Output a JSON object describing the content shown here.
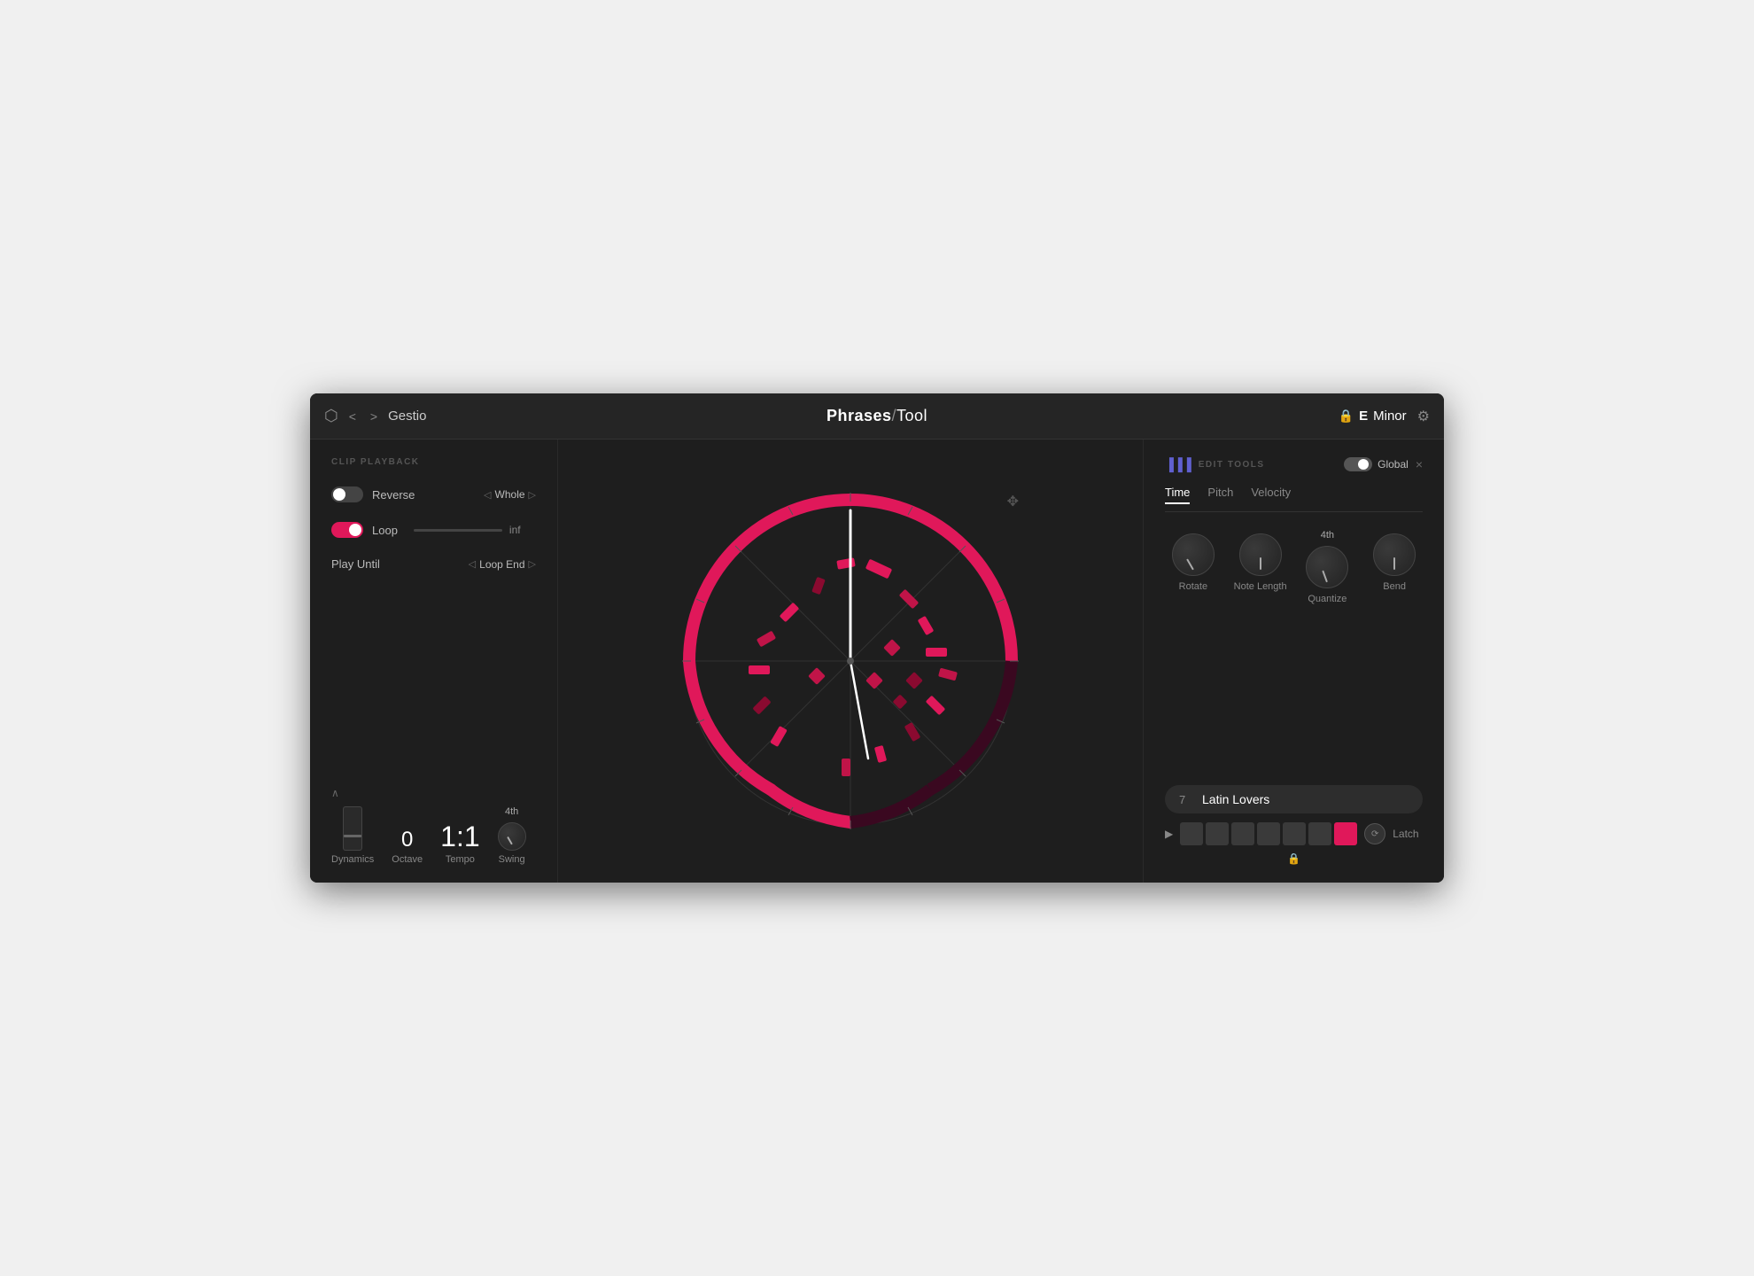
{
  "header": {
    "app_title": "Gestio",
    "logo_phrases": "Phrases",
    "logo_slash": "/",
    "logo_tool": "Tool",
    "key_note": "E",
    "key_scale": "Minor",
    "nav_back": "<",
    "nav_forward": ">"
  },
  "clip_playback": {
    "section_label": "CLIP PLAYBACK",
    "reverse_label": "Reverse",
    "reverse_active": false,
    "whole_label": "Whole",
    "loop_label": "Loop",
    "loop_active": true,
    "loop_end_label": "Loop End",
    "play_until_label": "Play Until",
    "inf_label": "inf"
  },
  "bottom_controls": {
    "dynamics_label": "Dynamics",
    "octave_label": "Octave",
    "octave_value": "0",
    "tempo_label": "Tempo",
    "tempo_value": "1:1",
    "swing_label": "Swing",
    "swing_4th": "4th"
  },
  "edit_tools": {
    "section_label": "EDIT TOOLS",
    "global_label": "Global",
    "tabs": [
      "Time",
      "Pitch",
      "Velocity"
    ],
    "active_tab": "Time",
    "knobs": [
      {
        "label": "Rotate",
        "sublabel": ""
      },
      {
        "label": "Note Length",
        "sublabel": ""
      },
      {
        "label": "Quantize",
        "sublabel": "4th"
      },
      {
        "label": "Bend",
        "sublabel": ""
      }
    ]
  },
  "phrase": {
    "number": "7",
    "name": "Latin Lovers",
    "latch_label": "Latch",
    "pads": [
      false,
      false,
      false,
      false,
      false,
      false,
      true
    ]
  },
  "icons": {
    "cube": "⬡",
    "gear": "⚙",
    "lock": "🔒",
    "move": "✥",
    "bars": "▐",
    "play": "▶",
    "random": "⟳",
    "chevron_up": "∧",
    "close": "×"
  }
}
